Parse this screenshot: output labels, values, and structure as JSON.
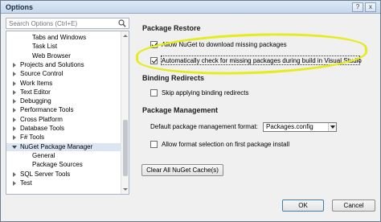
{
  "window": {
    "title": "Options",
    "help_label": "?",
    "close_label": "x"
  },
  "search": {
    "placeholder": "Search Options (Ctrl+E)"
  },
  "tree": {
    "items": [
      {
        "label": "Tabs and Windows",
        "indent": 2,
        "arrow": "none",
        "selected": false
      },
      {
        "label": "Task List",
        "indent": 2,
        "arrow": "none",
        "selected": false
      },
      {
        "label": "Web Browser",
        "indent": 2,
        "arrow": "none",
        "selected": false
      },
      {
        "label": "Projects and Solutions",
        "indent": 1,
        "arrow": "right",
        "selected": false
      },
      {
        "label": "Source Control",
        "indent": 1,
        "arrow": "right",
        "selected": false
      },
      {
        "label": "Work Items",
        "indent": 1,
        "arrow": "right",
        "selected": false
      },
      {
        "label": "Text Editor",
        "indent": 1,
        "arrow": "right",
        "selected": false
      },
      {
        "label": "Debugging",
        "indent": 1,
        "arrow": "right",
        "selected": false
      },
      {
        "label": "Performance Tools",
        "indent": 1,
        "arrow": "right",
        "selected": false
      },
      {
        "label": "Cross Platform",
        "indent": 1,
        "arrow": "right",
        "selected": false
      },
      {
        "label": "Database Tools",
        "indent": 1,
        "arrow": "right",
        "selected": false
      },
      {
        "label": "F# Tools",
        "indent": 1,
        "arrow": "right",
        "selected": false
      },
      {
        "label": "NuGet Package Manager",
        "indent": 1,
        "arrow": "down",
        "selected": true
      },
      {
        "label": "General",
        "indent": 2,
        "arrow": "none",
        "selected": false
      },
      {
        "label": "Package Sources",
        "indent": 2,
        "arrow": "none",
        "selected": false
      },
      {
        "label": "SQL Server Tools",
        "indent": 1,
        "arrow": "right",
        "selected": false
      },
      {
        "label": "Test",
        "indent": 1,
        "arrow": "right",
        "selected": false
      }
    ]
  },
  "package_restore": {
    "heading": "Package Restore",
    "allow_download": {
      "label": "Allow NuGet to download missing packages",
      "checked": true
    },
    "auto_check": {
      "label": "Automatically check for missing packages during build in Visual Studio",
      "checked": true
    }
  },
  "binding_redirects": {
    "heading": "Binding Redirects",
    "skip": {
      "label": "Skip applying binding redirects",
      "checked": false
    }
  },
  "package_management": {
    "heading": "Package Management",
    "format_label": "Default package management format:",
    "format_value": "Packages.config",
    "allow_format": {
      "label": "Allow format selection on first package install",
      "checked": false
    }
  },
  "clear_cache_label": "Clear All NuGet Cache(s)",
  "footer": {
    "ok_label": "OK",
    "cancel_label": "Cancel"
  },
  "colors": {
    "highlight": "#e6eb1a",
    "selection": "#dce5f2"
  }
}
